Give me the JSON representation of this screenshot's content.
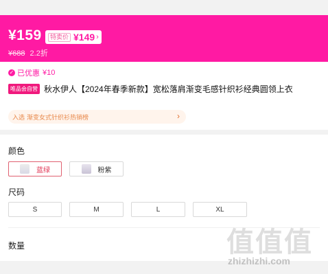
{
  "price": {
    "current": "¥159",
    "special_label": "特卖价",
    "special_price": "¥149",
    "original": "¥688",
    "discount": "2.2折"
  },
  "coupon": {
    "text": "已优惠",
    "value": "¥10"
  },
  "product": {
    "badge": "唯品会自营",
    "title": "秋水伊人【2024年春季新款】宽松落肩渐变毛感针织衫经典圆领上衣"
  },
  "ranking": {
    "prefix": "入选",
    "link": "渐变女式针织衫热销榜"
  },
  "color": {
    "label": "颜色",
    "options": [
      {
        "label": "蓝绿",
        "selected": true
      },
      {
        "label": "粉紫",
        "selected": false
      }
    ]
  },
  "size": {
    "label": "尺码",
    "options": [
      "S",
      "M",
      "L",
      "XL"
    ]
  },
  "quantity": {
    "label": "数量"
  },
  "watermark": {
    "text": "值值值",
    "url": "zhizhizhi.com"
  },
  "colors": {
    "brand_pink": "#ff1aa3",
    "selected_border": "#e06070"
  }
}
